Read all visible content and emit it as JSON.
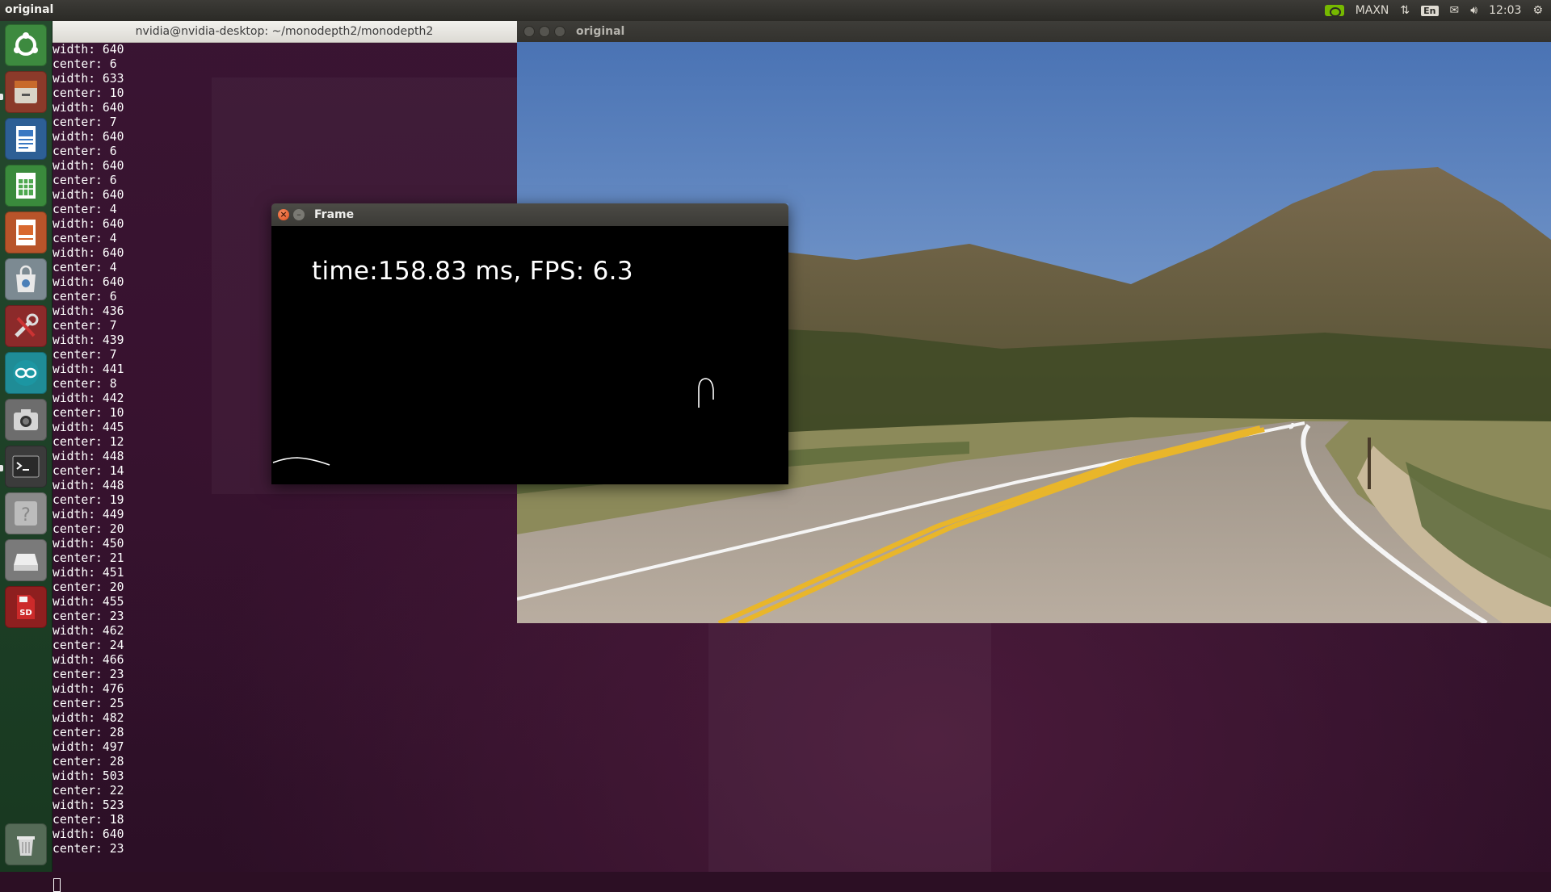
{
  "panel": {
    "title": "original",
    "power_mode": "MAXN",
    "keyboard_layout": "En",
    "clock": "12:03",
    "nvidia_color": "#76b900"
  },
  "launcher": {
    "items": [
      {
        "name": "ubuntu-dash",
        "icon": "ubuntu-logo-icon"
      },
      {
        "name": "files",
        "icon": "file-cabinet-icon"
      },
      {
        "name": "libreoffice-writer",
        "icon": "writer-document-icon"
      },
      {
        "name": "libreoffice-calc",
        "icon": "calc-spreadsheet-icon"
      },
      {
        "name": "libreoffice-impress",
        "icon": "impress-presentation-icon"
      },
      {
        "name": "software-center",
        "icon": "shopping-bag-icon"
      },
      {
        "name": "system-settings",
        "icon": "wrench-screwdriver-icon"
      },
      {
        "name": "arduino",
        "icon": "infinity-icon"
      },
      {
        "name": "camera",
        "icon": "camera-icon"
      },
      {
        "name": "terminal",
        "icon": "terminal-icon"
      },
      {
        "name": "help",
        "icon": "question-mark-icon"
      },
      {
        "name": "drive",
        "icon": "hard-drive-icon"
      },
      {
        "name": "sd-card",
        "icon": "sd-card-icon"
      },
      {
        "name": "trash",
        "icon": "trash-icon"
      }
    ]
  },
  "terminal": {
    "title": "nvidia@nvidia-desktop: ~/monodepth2/monodepth2",
    "lines": "width: 640\ncenter: 6\nwidth: 633\ncenter: 10\nwidth: 640\ncenter: 7\nwidth: 640\ncenter: 6\nwidth: 640\ncenter: 6\nwidth: 640\ncenter: 4\nwidth: 640\ncenter: 4\nwidth: 640\ncenter: 4\nwidth: 640\ncenter: 6\nwidth: 436\ncenter: 7\nwidth: 439\ncenter: 7\nwidth: 441\ncenter: 8\nwidth: 442\ncenter: 10\nwidth: 445\ncenter: 12\nwidth: 448\ncenter: 14\nwidth: 448\ncenter: 19\nwidth: 449\ncenter: 20\nwidth: 450\ncenter: 21\nwidth: 451\ncenter: 20\nwidth: 455\ncenter: 23\nwidth: 462\ncenter: 24\nwidth: 466\ncenter: 23\nwidth: 476\ncenter: 25\nwidth: 482\ncenter: 28\nwidth: 497\ncenter: 28\nwidth: 503\ncenter: 22\nwidth: 523\ncenter: 18\nwidth: 640\ncenter: 23"
  },
  "original_window": {
    "title": "original"
  },
  "frame_window": {
    "title": "Frame",
    "overlay_text": "time:158.83 ms, FPS: 6.3"
  }
}
